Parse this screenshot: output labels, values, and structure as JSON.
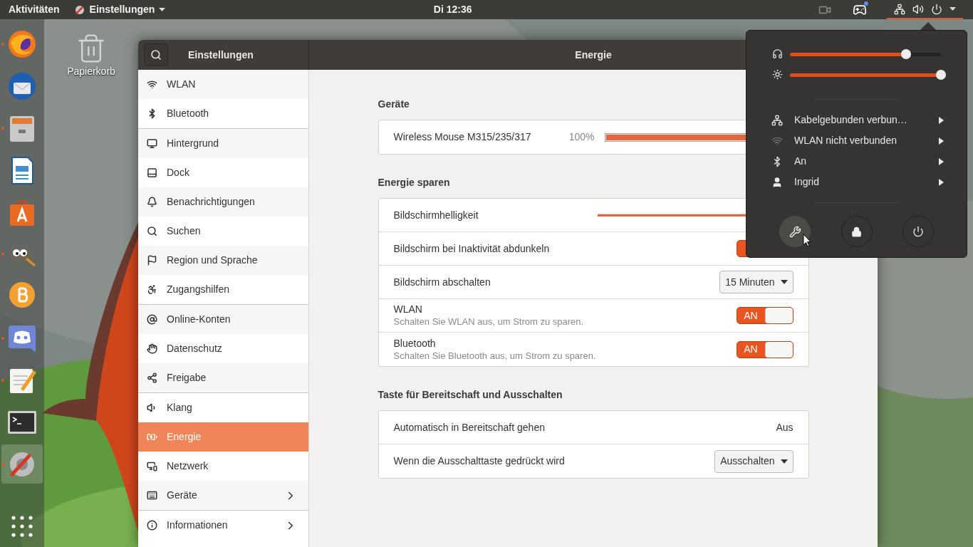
{
  "top_bar": {
    "activities": "Aktivitäten",
    "app_menu": "Einstellungen",
    "clock": "Di 12:36",
    "system_menu_open": true,
    "chat_notification": true
  },
  "dock": {
    "apps": [
      {
        "kind": "browser",
        "running": true,
        "selected": false
      },
      {
        "kind": "mail",
        "running": false,
        "selected": false
      },
      {
        "kind": "files",
        "running": true,
        "selected": false
      },
      {
        "kind": "document",
        "running": false,
        "selected": false
      },
      {
        "kind": "store",
        "running": false,
        "selected": false
      },
      {
        "kind": "paint",
        "running": true,
        "selected": false
      },
      {
        "kind": "coin",
        "running": false,
        "selected": false
      },
      {
        "kind": "chat",
        "running": true,
        "selected": false
      },
      {
        "kind": "editor",
        "running": true,
        "selected": false
      },
      {
        "kind": "terminal",
        "running": false,
        "selected": false
      },
      {
        "kind": "settings",
        "running": true,
        "selected": true
      }
    ]
  },
  "desktop_icons": [
    {
      "label": "Papierkorb"
    }
  ],
  "settings_window": {
    "sidebar_title": "Einstellungen",
    "page_title": "Energie",
    "sidebar": {
      "groups": [
        {
          "items": [
            {
              "label": "WLAN",
              "kind": "wifi",
              "selected": false,
              "submenu": false
            },
            {
              "label": "Bluetooth",
              "kind": "bluetooth",
              "selected": false,
              "submenu": false
            }
          ]
        },
        {
          "items": [
            {
              "label": "Hintergrund",
              "kind": "background",
              "selected": false,
              "submenu": false
            },
            {
              "label": "Dock",
              "kind": "dock",
              "selected": false,
              "submenu": false
            },
            {
              "label": "Benachrichtigungen",
              "kind": "bell",
              "selected": false,
              "submenu": false
            },
            {
              "label": "Suchen",
              "kind": "search",
              "selected": false,
              "submenu": false
            },
            {
              "label": "Region und Sprache",
              "kind": "region",
              "selected": false,
              "submenu": false
            },
            {
              "label": "Zugangshilfen",
              "kind": "access",
              "selected": false,
              "submenu": false
            }
          ]
        },
        {
          "items": [
            {
              "label": "Online-Konten",
              "kind": "accounts",
              "selected": false,
              "submenu": false
            },
            {
              "label": "Datenschutz",
              "kind": "privacy",
              "selected": false,
              "submenu": false
            },
            {
              "label": "Freigabe",
              "kind": "share",
              "selected": false,
              "submenu": false
            }
          ]
        },
        {
          "items": [
            {
              "label": "Klang",
              "kind": "sound",
              "selected": false,
              "submenu": false
            },
            {
              "label": "Energie",
              "kind": "power",
              "selected": true,
              "submenu": false
            },
            {
              "label": "Netzwerk",
              "kind": "network",
              "selected": false,
              "submenu": false
            },
            {
              "label": "Geräte",
              "kind": "devices",
              "selected": false,
              "submenu": true
            }
          ]
        },
        {
          "items": [
            {
              "label": "Informationen",
              "kind": "info",
              "selected": false,
              "submenu": true
            }
          ]
        }
      ]
    },
    "sections": [
      {
        "title": "Geräte",
        "rows": [
          {
            "kind": "battery",
            "label": "Wireless Mouse M315/235/317",
            "reading": "100%",
            "level": 1
          }
        ]
      },
      {
        "title": "Energie sparen",
        "rows": [
          {
            "kind": "slider",
            "label": "Bildschirmhelligkeit",
            "level": 1
          },
          {
            "kind": "toggle",
            "label": "Bildschirm bei Inaktivität abdunkeln",
            "on": true
          },
          {
            "kind": "dropdown",
            "label": "Bildschirm abschalten",
            "value": "15 Minuten"
          },
          {
            "kind": "toggle",
            "label": "WLAN",
            "description": "Schalten Sie WLAN aus, um Strom zu sparen.",
            "on": true,
            "state_label": "AN"
          },
          {
            "kind": "toggle",
            "label": "Bluetooth",
            "description": "Schalten Sie Bluetooth aus, um Strom zu sparen.",
            "on": true,
            "state_label": "AN"
          }
        ]
      },
      {
        "title": "Taste für Bereitschaft und Ausschalten",
        "rows": [
          {
            "kind": "value",
            "label": "Automatisch in Bereitschaft gehen",
            "value": "Aus"
          },
          {
            "kind": "dropdown",
            "label": "Wenn die Ausschalttaste gedrückt wird",
            "value": "Ausschalten"
          }
        ]
      }
    ]
  },
  "system_menu": {
    "sliders": [
      {
        "kind": "volume",
        "level": 0.76
      },
      {
        "kind": "brightness",
        "level": 1
      }
    ],
    "items": [
      {
        "kind": "wired",
        "label": "Kabelgebunden verbun…",
        "active": true
      },
      {
        "kind": "wifi",
        "label": "WLAN nicht verbunden",
        "active": false
      },
      {
        "kind": "bluetooth",
        "label": "An",
        "active": true
      },
      {
        "kind": "user",
        "label": "Ingrid",
        "active": true
      }
    ],
    "actions": [
      {
        "kind": "settings",
        "hovered": true
      },
      {
        "kind": "lock",
        "hovered": false
      },
      {
        "kind": "power",
        "hovered": false
      }
    ]
  }
}
